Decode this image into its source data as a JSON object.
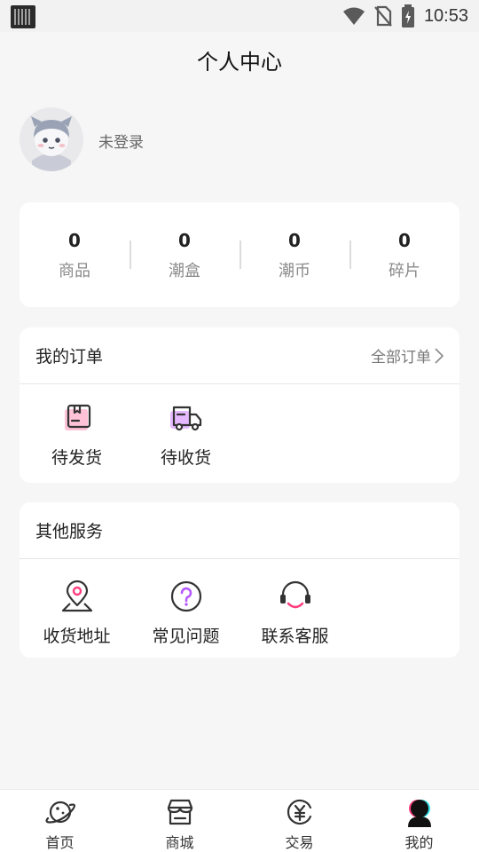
{
  "status_bar": {
    "time": "10:53",
    "icons": [
      "qr-icon",
      "wifi-icon",
      "no-sim-icon",
      "battery-charging-icon"
    ]
  },
  "header": {
    "title": "个人中心"
  },
  "profile": {
    "login_text": "未登录",
    "avatar_icon": "avatar-icon"
  },
  "stats": [
    {
      "value": "0",
      "label": "商品"
    },
    {
      "value": "0",
      "label": "潮盒"
    },
    {
      "value": "0",
      "label": "潮币"
    },
    {
      "value": "0",
      "label": "碎片"
    }
  ],
  "orders": {
    "title": "我的订单",
    "all_label": "全部订单",
    "items": [
      {
        "label": "待发货",
        "icon": "box-icon"
      },
      {
        "label": "待收货",
        "icon": "truck-icon"
      }
    ]
  },
  "services": {
    "title": "其他服务",
    "items": [
      {
        "label": "收货地址",
        "icon": "location-pin-icon"
      },
      {
        "label": "常见问题",
        "icon": "question-circle-icon"
      },
      {
        "label": "联系客服",
        "icon": "headset-icon"
      }
    ]
  },
  "tabbar": {
    "items": [
      {
        "label": "首页",
        "icon": "planet-icon"
      },
      {
        "label": "商城",
        "icon": "store-icon"
      },
      {
        "label": "交易",
        "icon": "yuan-coin-icon"
      },
      {
        "label": "我的",
        "icon": "user-icon",
        "active": true
      }
    ]
  },
  "colors": {
    "accent_pink": "#ff3d7f",
    "accent_purple": "#b659ff",
    "accent_cyan": "#2ee6f0",
    "background": "#f6f6f7"
  }
}
